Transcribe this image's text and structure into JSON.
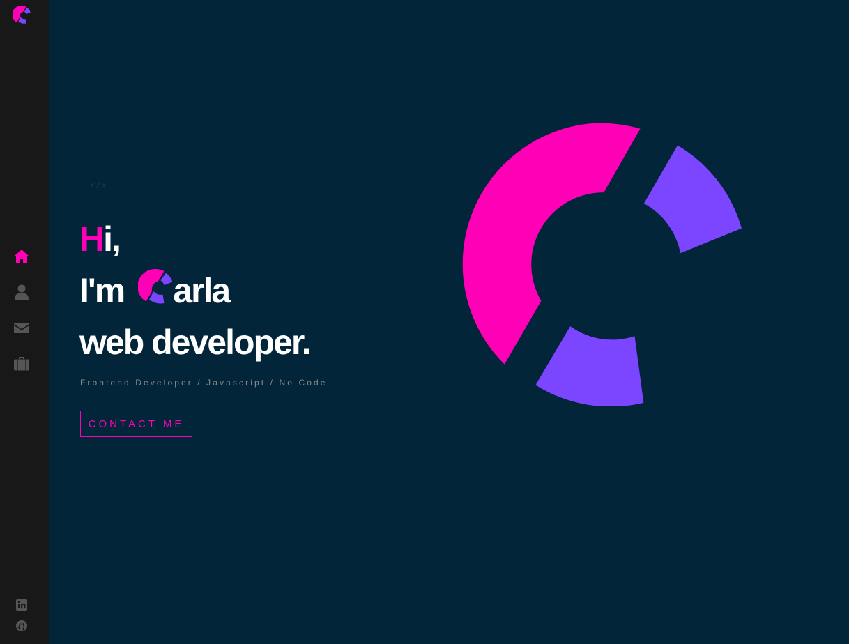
{
  "brand": {
    "logo_icon": "c-logo-icon",
    "colors": {
      "pink": "#ff00b6",
      "purple": "#7c45ff",
      "sidebar": "#181818",
      "background": "#022539"
    }
  },
  "sidebar": {
    "nav": [
      {
        "id": "home",
        "icon": "home-icon",
        "active": true
      },
      {
        "id": "about",
        "icon": "user-icon",
        "active": false
      },
      {
        "id": "contact",
        "icon": "envelope-icon",
        "active": false
      },
      {
        "id": "portfolio",
        "icon": "suitcase-icon",
        "active": false
      }
    ],
    "social": [
      {
        "id": "linkedin",
        "icon": "linkedin-icon"
      },
      {
        "id": "github",
        "icon": "github-icon"
      }
    ]
  },
  "hero": {
    "tag": "</>",
    "line1_accent": "H",
    "line1_rest": "i,",
    "line2_prefix": "I'm",
    "line2_name_rest": "arla",
    "line3": "web developer.",
    "subtitle": "Frontend Developer / Javascript / No Code",
    "cta_label": "CONTACT ME"
  }
}
